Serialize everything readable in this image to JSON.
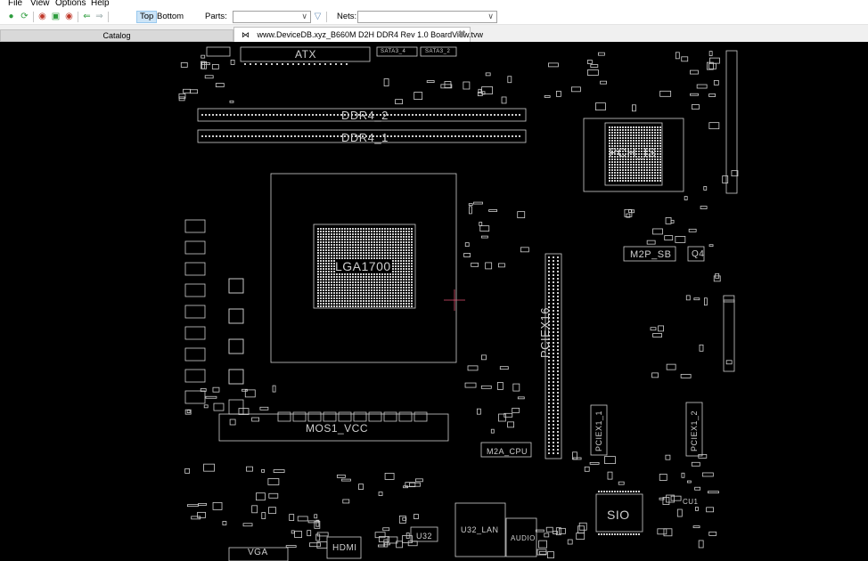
{
  "menu": [
    "File",
    "View",
    "Options",
    "Help"
  ],
  "toolbar": {
    "icons": [
      "open-green-icon",
      "reload-green-icon",
      "zoom-out-icon",
      "fit-icon",
      "zoom-in-icon",
      "back-arrow-icon",
      "forward-arrow-icon"
    ],
    "side_top": "Top",
    "side_bottom": "Bottom",
    "parts_label": "Parts:",
    "parts_value": "",
    "nets_label": "Nets:",
    "nets_value": ""
  },
  "tabs": {
    "catalog": "Catalog",
    "file": "www.DeviceDB.xyz_B660M D2H DDR4 Rev 1.0 BoardView.tvw"
  },
  "board": {
    "labels": {
      "atx": "ATX",
      "sata_a": "SATA3_4",
      "sata_b": "SATA3_2",
      "ddr4_2": "DDR4_2",
      "ddr4_1": "DDR4_1",
      "pch": "PCH_IS",
      "lga": "LGA1700",
      "m2p_sb": "M2P_SB",
      "q4": "Q4",
      "pciex16": "PCIEX16",
      "pciex1_1": "PCIEX1_1",
      "pciex1_2": "PCIEX1_2",
      "m2a_cpu": "M2A_CPU",
      "mos": "MOS1_VCC",
      "sio": "SIO",
      "u32_lan": "U32_LAN",
      "audio": "AUDIO",
      "u32": "U32",
      "hdmi": "HDMI",
      "vga": "VGA",
      "cu1": "CU1"
    }
  },
  "colors": {
    "board_bg": "#000000",
    "silkscreen": "#cfcfcf",
    "cursor": "#e05070",
    "active_side": "#cce4f7"
  }
}
